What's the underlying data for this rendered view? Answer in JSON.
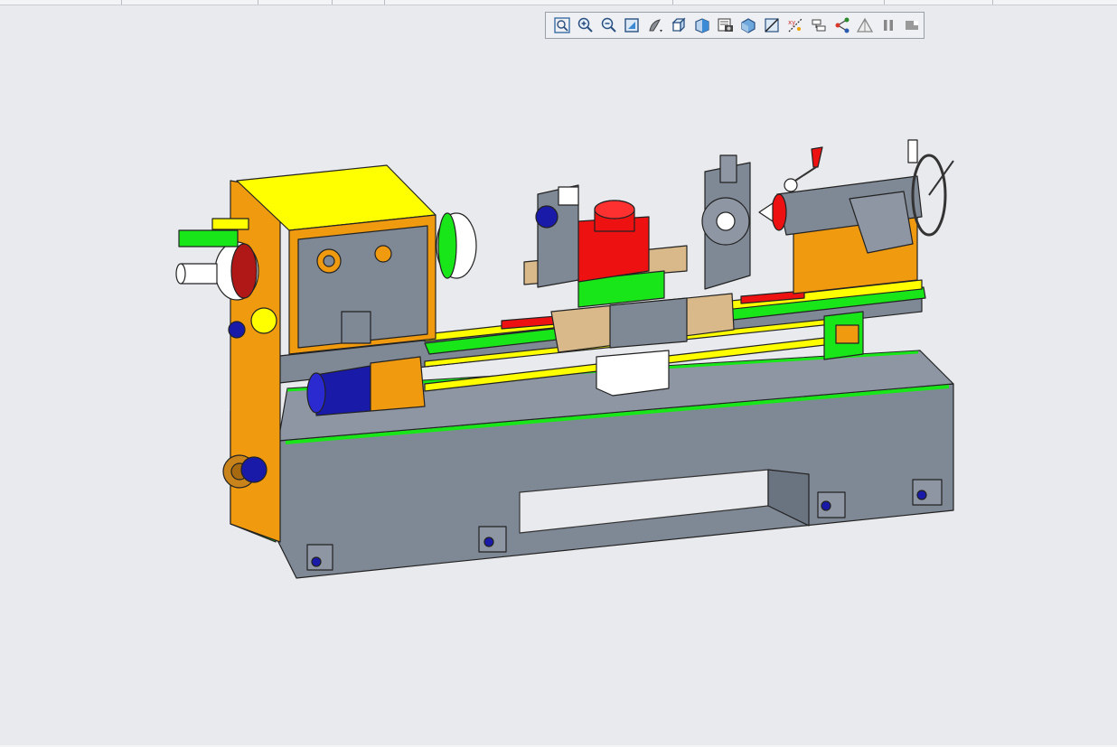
{
  "app": {
    "view": "3D model viewer"
  },
  "toolbar": {
    "tools": [
      {
        "icon": "fit-all-icon"
      },
      {
        "icon": "zoom-in-icon"
      },
      {
        "icon": "zoom-out-icon"
      },
      {
        "icon": "zoom-window-icon"
      },
      {
        "icon": "render-style-icon"
      },
      {
        "icon": "standard-views-icon"
      },
      {
        "icon": "perspective-icon"
      },
      {
        "icon": "capture-image-icon"
      },
      {
        "icon": "section-view-icon"
      },
      {
        "icon": "measure-icon"
      },
      {
        "icon": "annotations-icon"
      },
      {
        "icon": "explode-icon"
      },
      {
        "icon": "model-tree-icon"
      },
      {
        "icon": "measure-triangle-icon"
      },
      {
        "icon": "pause-icon"
      },
      {
        "icon": "presentation-icon"
      }
    ]
  },
  "colors": {
    "background": "#e9eaed",
    "bed": "#7f8895",
    "headstock_top": "#ffff00",
    "headstock_side": "#f09a10",
    "green_parts": "#19e619",
    "red_parts": "#ee1111",
    "tan_parts": "#d9b98a",
    "blue_parts": "#1a1aa8"
  }
}
